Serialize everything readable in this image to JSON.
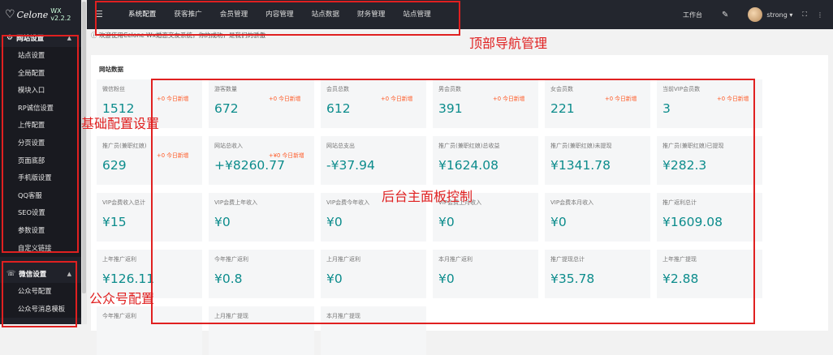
{
  "app": {
    "brand": "Celone",
    "version": "WX v2.2.2"
  },
  "sidebar": {
    "groups": [
      {
        "title": "网站设置",
        "items": [
          "站点设置",
          "全局配置",
          "模块入口",
          "RP诚信设置",
          "上传配置",
          "分页设置",
          "页面底部",
          "手机版设置",
          "QQ客服",
          "SEO设置",
          "参数设置",
          "自定义链接"
        ]
      },
      {
        "title": "微信设置",
        "items": [
          "公众号配置",
          "公众号消息模板"
        ]
      }
    ]
  },
  "topbar": {
    "tabs": [
      "系统配置",
      "获客推广",
      "会员管理",
      "内容管理",
      "站点数据",
      "财务管理",
      "站点管理"
    ],
    "workbench": "工作台",
    "username": "strong"
  },
  "notice": "欢迎使用Celone Wx婚恋交友系统，你的成功，是我们的骄傲",
  "panel": {
    "title": "网站数据"
  },
  "stats": [
    {
      "label": "微信粉丝",
      "value": "1512",
      "inc": "+0 今日新增"
    },
    {
      "label": "游客数量",
      "value": "672",
      "inc": "+0 今日新增"
    },
    {
      "label": "会员总数",
      "value": "612",
      "inc": "+0 今日新增"
    },
    {
      "label": "男会员数",
      "value": "391",
      "inc": "+0 今日新增"
    },
    {
      "label": "女会员数",
      "value": "221",
      "inc": "+0 今日新增"
    },
    {
      "label": "当前VIP会员数",
      "value": "3",
      "inc": "+0 今日新增"
    },
    {
      "label": "推广员(兼职红娘)",
      "value": "629",
      "inc": "+0 今日新增"
    },
    {
      "label": "网站总收入",
      "value": "+¥8260.77",
      "inc": "+¥0 今日新增"
    },
    {
      "label": "网站总支出",
      "value": "-¥37.94",
      "inc": ""
    },
    {
      "label": "推广员(兼职红娘)总收益",
      "value": "¥1624.08",
      "inc": ""
    },
    {
      "label": "推广员(兼职红娘)未提现",
      "value": "¥1341.78",
      "inc": ""
    },
    {
      "label": "推广员(兼职红娘)已提现",
      "value": "¥282.3",
      "inc": ""
    },
    {
      "label": "VIP会费收入总计",
      "value": "¥15",
      "inc": ""
    },
    {
      "label": "VIP会费上年收入",
      "value": "¥0",
      "inc": ""
    },
    {
      "label": "VIP会费今年收入",
      "value": "¥0",
      "inc": ""
    },
    {
      "label": "VIP会费上月收入",
      "value": "¥0",
      "inc": ""
    },
    {
      "label": "VIP会费本月收入",
      "value": "¥0",
      "inc": ""
    },
    {
      "label": "推广返利总计",
      "value": "¥1609.08",
      "inc": ""
    },
    {
      "label": "上年推广返利",
      "value": "¥126.11",
      "inc": ""
    },
    {
      "label": "今年推广返利",
      "value": "¥0.8",
      "inc": ""
    },
    {
      "label": "上月推广返利",
      "value": "¥0",
      "inc": ""
    },
    {
      "label": "本月推广返利",
      "value": "¥0",
      "inc": ""
    },
    {
      "label": "推广提现总计",
      "value": "¥35.78",
      "inc": ""
    },
    {
      "label": "上年推广提现",
      "value": "¥2.88",
      "inc": ""
    },
    {
      "label": "今年推广返利",
      "value": "",
      "inc": ""
    },
    {
      "label": "上月推广提现",
      "value": "",
      "inc": ""
    },
    {
      "label": "本月推广提现",
      "value": "",
      "inc": ""
    }
  ],
  "annotations": {
    "top_nav": "顶部导航管理",
    "basic_config": "基础配置设置",
    "main_panel": "后台主面板控制",
    "wechat_config": "公众号配置"
  },
  "colors": {
    "annotation": "#e02020",
    "value_text": "#0c8c8c",
    "increase": "#ff5722",
    "sidebar_bg": "#20222a"
  }
}
